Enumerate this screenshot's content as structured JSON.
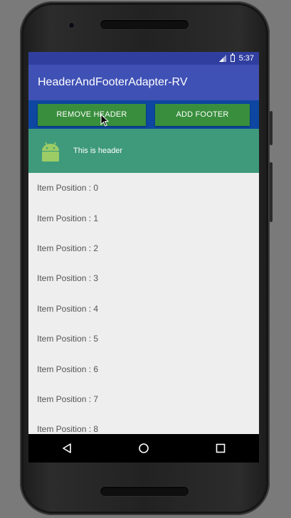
{
  "status_bar": {
    "time": "5:37"
  },
  "app_bar": {
    "title": "HeaderAndFooterAdapter-RV"
  },
  "actions": {
    "remove_header_label": "REMOVE HEADER",
    "add_footer_label": "ADD FOOTER"
  },
  "header": {
    "text": "This is header",
    "icon": "android-icon"
  },
  "list": {
    "items": [
      "Item Position : 0",
      "Item Position : 1",
      "Item Position : 2",
      "Item Position : 3",
      "Item Position : 4",
      "Item Position : 5",
      "Item Position : 6",
      "Item Position : 7",
      "Item Position : 8"
    ]
  },
  "nav": {
    "back_icon": "back-icon",
    "home_icon": "home-icon",
    "recents_icon": "recents-icon"
  },
  "colors": {
    "status_bar": "#303f9f",
    "app_bar": "#3f51b5",
    "button_bar": "#0d47a1",
    "button": "#388e3c",
    "header": "#3e9a7b",
    "list_bg": "#eeeeee"
  }
}
